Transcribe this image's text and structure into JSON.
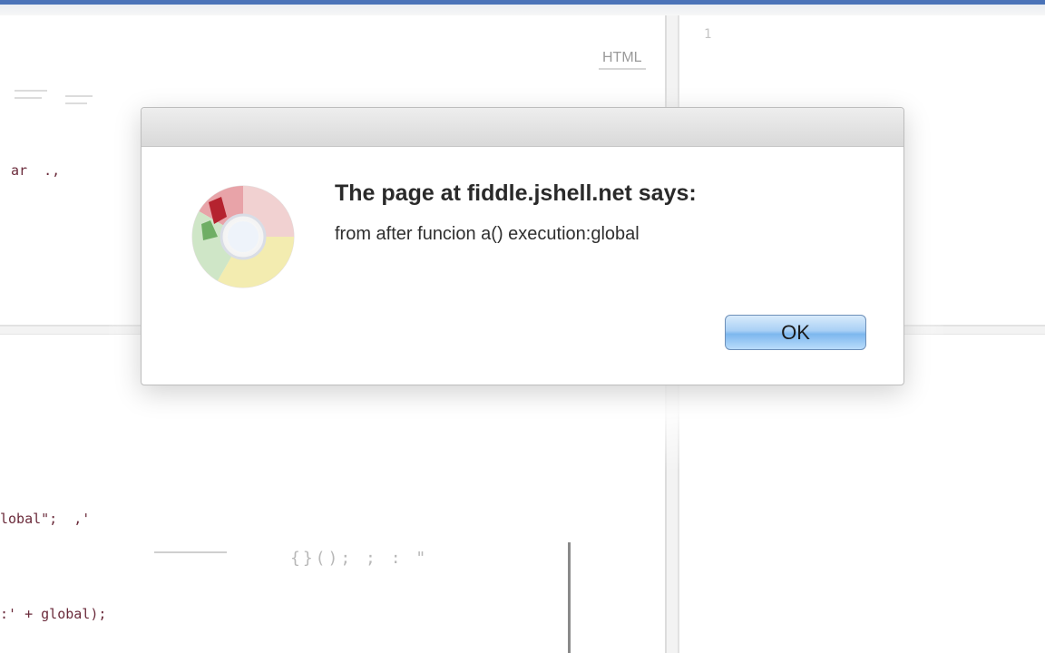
{
  "editor": {
    "html_pane_label": "HTML",
    "css_line_number": "1",
    "code_fragments": {
      "line_var": "ar  .,",
      "line_global_assign": "lobal\";  ,'",
      "line_alert_call": ":' + global);"
    },
    "faint_text": "{}();  ;  :  \""
  },
  "dialog": {
    "title": "The page at fiddle.jshell.net says:",
    "message": "from after funcion a() execution:global",
    "ok_label": "OK",
    "icon": "chrome-icon"
  }
}
